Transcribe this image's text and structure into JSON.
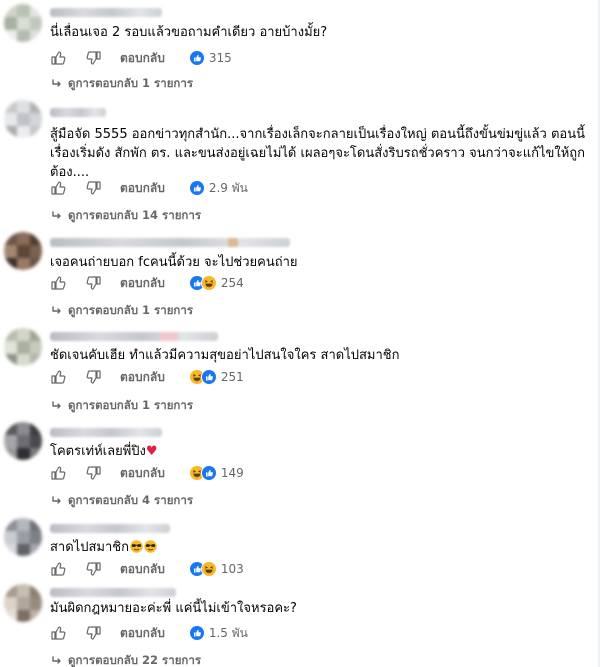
{
  "comments": [
    {
      "text": "นี่เลื่อนเจอ 2 รอบแล้วขอถามคำเดียว อายบ้างมั้ย?",
      "reply_label": "ตอบกลับ",
      "reaction_icons": [
        "like"
      ],
      "reaction_count": "315",
      "replies_label": "ดูการตอบกลับ 1 รายการ",
      "avatar_colors": [
        "#cfd3cc",
        "#b8c2b4",
        "#e3e6e0",
        "#a7b0a2",
        "#d9ddd6",
        "#c0c8bc",
        "#edf0ea",
        "#b3bcaf",
        "#dde1da"
      ]
    },
    {
      "text": "สู้มือจัด 5555 ออกข่าวทุกสำนัก...จากเรื่องเล็กจะกลายเป็นเรื่องใหญ่ ตอนนี้ถึงขั้นข่มขู่แล้ว ตอนนี้เรื่องเริ่มดัง สักพัก ตร. และขนส่งอยู่เฉยไม่ได้ เผลอๆจะโดนสั่งริบรถชั่วคราว จนกว่าจะแก้ไขให้ถูกต้อง....",
      "reply_label": "ตอบกลับ",
      "reaction_icons": [
        "like"
      ],
      "reaction_count": "2.9 พัน",
      "replies_label": "ดูการตอบกลับ 14 รายการ",
      "avatar_colors": [
        "#c7c9cc",
        "#dfe1e3",
        "#aeb1b5",
        "#e8e9eb",
        "#bfc2c6",
        "#d3d5d8",
        "#a9acb0",
        "#ecedef",
        "#c4c6ca"
      ]
    },
    {
      "text": "เจอคนถ่ายบอก fcคนนี้ด้วย จะไปช่วยคนถ่าย",
      "reply_label": "ตอบกลับ",
      "reaction_icons": [
        "like",
        "haha"
      ],
      "reaction_count": "254",
      "replies_label": "ดูการตอบกลับ 1 รายการ",
      "avatar_colors": [
        "#6e5546",
        "#8a6d5a",
        "#4f3c31",
        "#a4876f",
        "#5d473a",
        "#7c624f",
        "#3f302a",
        "#967a63",
        "#6a5243"
      ]
    },
    {
      "text": "ชัดเจนคับเฮีย ทำแล้วมีความสุขอย่าไปสนใจใคร สาดไปสมาชิก",
      "reply_label": "ตอบกลับ",
      "reaction_icons": [
        "haha",
        "like"
      ],
      "reaction_count": "251",
      "replies_label": "ดูการตอบกลับ 1 รายการ",
      "avatar_colors": [
        "#b9bdb0",
        "#d2d6c9",
        "#9fa596",
        "#e1e4da",
        "#aab09f",
        "#c6cabd",
        "#8e9585",
        "#d8dbd0",
        "#b2b7a8"
      ]
    },
    {
      "text": "โคตรเท่ห์เลยพี่ปิง",
      "reply_label": "ตอบกลับ",
      "reaction_icons": [
        "haha",
        "like"
      ],
      "reaction_count": "149",
      "replies_label": "ดูการตอบกลับ 4 รายการ",
      "avatar_colors": [
        "#5a5a5e",
        "#8c8c90",
        "#3d3d41",
        "#a6a6aa",
        "#6e6e72",
        "#4a4a4e",
        "#9a9a9e",
        "#2f2f33",
        "#7a7a7e"
      ]
    },
    {
      "text": "สาดไปสมาชิก",
      "reply_label": "ตอบกลับ",
      "reaction_icons": [
        "like",
        "haha"
      ],
      "reaction_count": "103",
      "replies_label": "",
      "avatar_colors": [
        "#8d9097",
        "#b4b7bd",
        "#6f737a",
        "#c9ccd1",
        "#9a9ea4",
        "#7e8288",
        "#d6d8dc",
        "#5f6369",
        "#a5a9ae"
      ]
    },
    {
      "text": "มันผิดกฎหมายอะค่ะพี่ แค่นี้ไม่เข้าใจหรอคะ?",
      "reply_label": "ตอบกลับ",
      "reaction_icons": [
        "like"
      ],
      "reaction_count": "1.5 พัน",
      "replies_label": "ดูการตอบกลับ 22 รายการ",
      "avatar_colors": [
        "#a69a8e",
        "#c8bdb1",
        "#8b7f73",
        "#ddd3c8",
        "#b3a79b",
        "#978b7f",
        "#e6ded5",
        "#7c7065",
        "#bfb3a7"
      ]
    }
  ],
  "colors": {
    "like_blue": "#1877f2",
    "haha_yellow": "#f7b928",
    "meta_gray": "#65676b",
    "heart_red": "#e41e3f"
  },
  "icons": {
    "like": "thumbs-up-icon",
    "dislike": "thumbs-down-icon",
    "replies": "reply-arrow-icon",
    "heart": "red-heart-emoji",
    "sunglasses": "sunglasses-emoji"
  }
}
